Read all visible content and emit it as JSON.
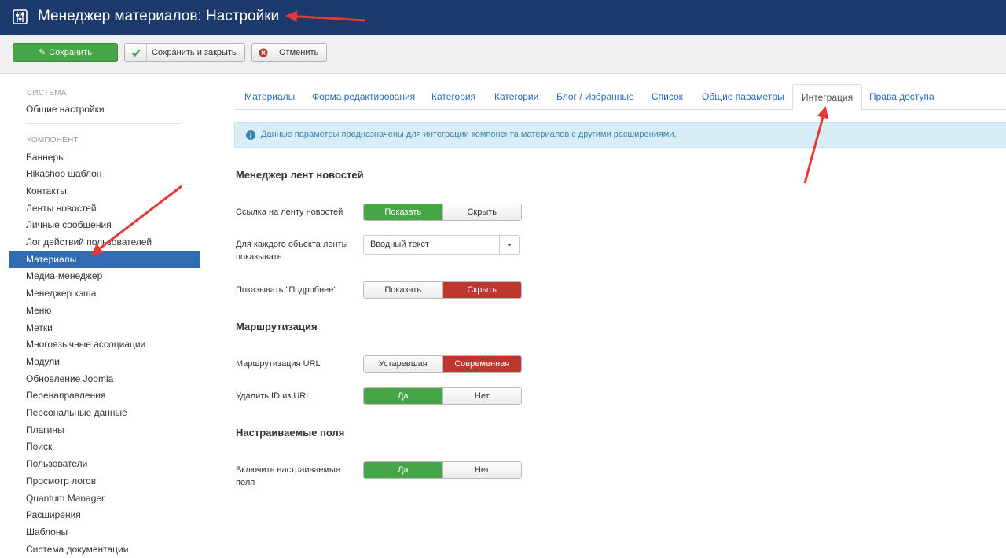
{
  "header": {
    "title": "Менеджер материалов: Настройки",
    "icon": "sliders-icon"
  },
  "toolbar": {
    "save": "Сохранить",
    "save_close": "Сохранить и закрыть",
    "cancel": "Отменить"
  },
  "sidebar": {
    "system_heading": "СИСТЕМА",
    "system_items": [
      "Общие настройки"
    ],
    "component_heading": "КОМПОНЕНТ",
    "items": [
      "Баннеры",
      "Hikashop шаблон",
      "Контакты",
      "Ленты новостей",
      "Личные сообщения",
      "Лог действий пользователей",
      "Материалы",
      "Медиа-менеджер",
      "Менеджер кэша",
      "Меню",
      "Метки",
      "Многоязычные ассоциации",
      "Модули",
      "Обновление Joomla",
      "Перенаправления",
      "Персональные данные",
      "Плагины",
      "Поиск",
      "Пользователи",
      "Просмотр логов",
      "Quantum Manager",
      "Расширения",
      "Шаблоны",
      "Система документации"
    ],
    "active_item": "Материалы"
  },
  "tabs": [
    "Материалы",
    "Форма редактирования",
    "Категория",
    "Категории",
    "Блог / Избранные",
    "Список",
    "Общие параметры",
    "Интеграция",
    "Права доступа"
  ],
  "active_tab": "Интеграция",
  "alert": "Данные параметры предназначены для интеграции компонента материалов с другими расширениями.",
  "sections": {
    "feeds": {
      "title": "Менеджер лент новостей",
      "feed_link_label": "Ссылка на ленту новостей",
      "feed_link_options": [
        "Показать",
        "Скрыть"
      ],
      "feed_link_value": "Показать",
      "feed_show_label": "Для каждого объекта ленты показывать",
      "feed_show_value": "Вводный текст",
      "readmore_label": "Показывать \"Подробнее\"",
      "readmore_options": [
        "Показать",
        "Скрыть"
      ],
      "readmore_value": "Скрыть"
    },
    "routing": {
      "title": "Маршрутизация",
      "url_routing_label": "Маршрутизация URL",
      "url_routing_options": [
        "Устаревшая",
        "Современная"
      ],
      "url_routing_value": "Современная",
      "remove_id_label": "Удалить ID из URL",
      "remove_id_options": [
        "Да",
        "Нет"
      ],
      "remove_id_value": "Да"
    },
    "fields": {
      "title": "Настраиваемые поля",
      "enable_label": "Включить настраиваемые поля",
      "enable_options": [
        "Да",
        "Нет"
      ],
      "enable_value": "Да"
    }
  },
  "colors": {
    "header": "#1b3a6b",
    "green": "#46a546",
    "red": "#bd362f",
    "active": "#2f6cb3",
    "arrow": "#e53935"
  }
}
